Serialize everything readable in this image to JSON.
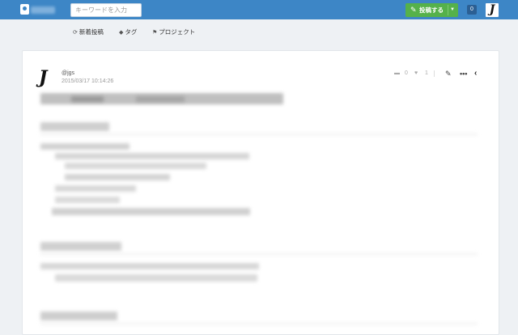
{
  "header": {
    "search": {
      "placeholder": "キーワードを入力",
      "value": ""
    },
    "post_button": {
      "label": "投稿する",
      "icon": "pencil-icon"
    },
    "notifications": {
      "count": "0"
    },
    "avatar_glyph": "J"
  },
  "subnav": {
    "items": [
      {
        "label": "新着投稿",
        "icon": "new-posts-icon"
      },
      {
        "label": "タグ",
        "icon": "tag-icon"
      },
      {
        "label": "プロジェクト",
        "icon": "flag-icon"
      }
    ]
  },
  "post": {
    "author_glyph": "J",
    "author": "@jgs",
    "date": "2015/03/17 10:14:26",
    "stock_count": "0",
    "like_count": "1"
  },
  "colors": {
    "header_bg": "#3d86c6",
    "post_button": "#55b14a",
    "page_bg": "#eef1f4"
  }
}
